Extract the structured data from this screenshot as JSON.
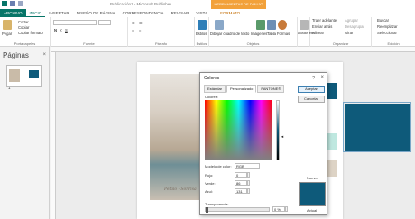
{
  "window": {
    "title": "Publicación1 - Microsoft Publisher",
    "context_tab_group": "HERRAMIENTAS DE DIBUJO"
  },
  "tabs": [
    {
      "label": "ARCHIVO"
    },
    {
      "label": "INICIO"
    },
    {
      "label": "INSERTAR"
    },
    {
      "label": "DISEÑO DE PÁGINA"
    },
    {
      "label": "CORRESPONDENCIA"
    },
    {
      "label": "REVISAR"
    },
    {
      "label": "VISTA"
    },
    {
      "label": "FORMATO"
    }
  ],
  "ribbon": {
    "clipboard": {
      "paste": "Pegar",
      "cut": "Cortar",
      "copy": "Copiar",
      "format_painter": "Copiar formato",
      "label": "Portapapeles"
    },
    "font": {
      "label": "Fuente"
    },
    "paragraph": {
      "label": "Párrafo"
    },
    "styles": {
      "button": "Estilos",
      "label": "Estilos"
    },
    "objects": {
      "draw_textbox": "Dibujar cuadro de texto",
      "pictures": "Imágenes",
      "table": "Tabla",
      "shapes": "Formas",
      "label": "Objetos"
    },
    "fit_text": "Ajustar texto",
    "arrange": {
      "bring_forward": "Traer adelante",
      "send_backward": "Enviar atrás",
      "align": "Alinear",
      "group": "Agrupar",
      "ungroup": "Desagrupar",
      "rotate": "Girar",
      "label": "Organizar"
    },
    "editing": {
      "find": "Buscar",
      "replace": "Reemplazar",
      "select": "Seleccionar",
      "label": "Edición"
    }
  },
  "pages_panel": {
    "title": "Páginas",
    "page_number": "1"
  },
  "document": {
    "photo_caption": "Pétalo · Sonrisa"
  },
  "dialog": {
    "title": "Colores",
    "help": "?",
    "tabs": [
      {
        "label": "Estándar"
      },
      {
        "label": "Personalizado"
      },
      {
        "label": "PANTONE®"
      }
    ],
    "ok": "Aceptar",
    "cancel": "Cancelar",
    "colors_label": "Colores:",
    "model_label": "Modelo de color:",
    "model_value": "RGB",
    "red_label": "Rojo:",
    "red_value": "0",
    "green_label": "Verde:",
    "green_value": "86",
    "blue_label": "Azul:",
    "blue_value": "131",
    "new_label": "Nuevo",
    "current_label": "Actual",
    "transparency_label": "Transparencia:",
    "transparency_value": "0 %"
  },
  "colors": {
    "accent": "#077568",
    "selected_fill": "#0e5a7a",
    "context_tab": "#f2a13a"
  }
}
